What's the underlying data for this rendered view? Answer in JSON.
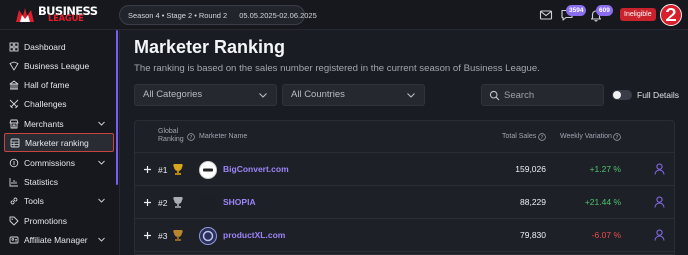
{
  "header": {
    "logo_line1": "BUSINESS",
    "logo_line2": "LEAGUE",
    "season": "Season 4",
    "stage": "Stage 2",
    "round": "Round 2",
    "dates": "05.05.2025-02.06.2025",
    "message_count": "3594",
    "notification_count": "609",
    "status_badge": "Ineligible"
  },
  "sidebar": {
    "items": [
      {
        "label": "Dashboard",
        "icon": "grid-icon"
      },
      {
        "label": "Business League",
        "icon": "shield-icon"
      },
      {
        "label": "Hall of fame",
        "icon": "building-icon"
      },
      {
        "label": "Challenges",
        "icon": "swords-icon"
      },
      {
        "label": "Merchants",
        "icon": "store-icon",
        "has_children": true
      },
      {
        "label": "Marketer ranking",
        "icon": "ranking-icon",
        "active": true
      },
      {
        "label": "Commissions",
        "icon": "coins-icon",
        "has_children": true
      },
      {
        "label": "Statistics",
        "icon": "chart-icon"
      },
      {
        "label": "Tools",
        "icon": "link-icon",
        "has_children": true
      },
      {
        "label": "Promotions",
        "icon": "tag-icon"
      },
      {
        "label": "Affiliate Manager",
        "icon": "user-card-icon",
        "has_children": true
      }
    ]
  },
  "page": {
    "title": "Marketer Ranking",
    "subtitle": "The ranking is based on the sales number registered in the current season of Business League.",
    "category_filter": "All Categories",
    "country_filter": "All Countries",
    "search_placeholder": "Search",
    "full_details_label": "Full Details",
    "full_details_on": false
  },
  "table": {
    "col_rank_l1": "Global",
    "col_rank_l2": "Ranking",
    "col_name": "Marketer Name",
    "col_sales": "Total Sales",
    "col_variation": "Weekly Variation",
    "rows": [
      {
        "rank": "#1",
        "trophy": "gold",
        "name": "BigConvert.com",
        "sales": "159,026",
        "variation": "+1.27 %",
        "trend": "up"
      },
      {
        "rank": "#2",
        "trophy": "silver",
        "name": "SHOPIA",
        "sales": "88,229",
        "variation": "+21.44 %",
        "trend": "up"
      },
      {
        "rank": "#3",
        "trophy": "bronze",
        "name": "productXL.com",
        "sales": "79,830",
        "variation": "-6.07 %",
        "trend": "down"
      }
    ]
  },
  "colors": {
    "accent": "#8b6ef0",
    "brand_red": "#e11d2a",
    "positive": "#4cc36a",
    "negative": "#ea4b4b",
    "link": "#9d84f7"
  }
}
